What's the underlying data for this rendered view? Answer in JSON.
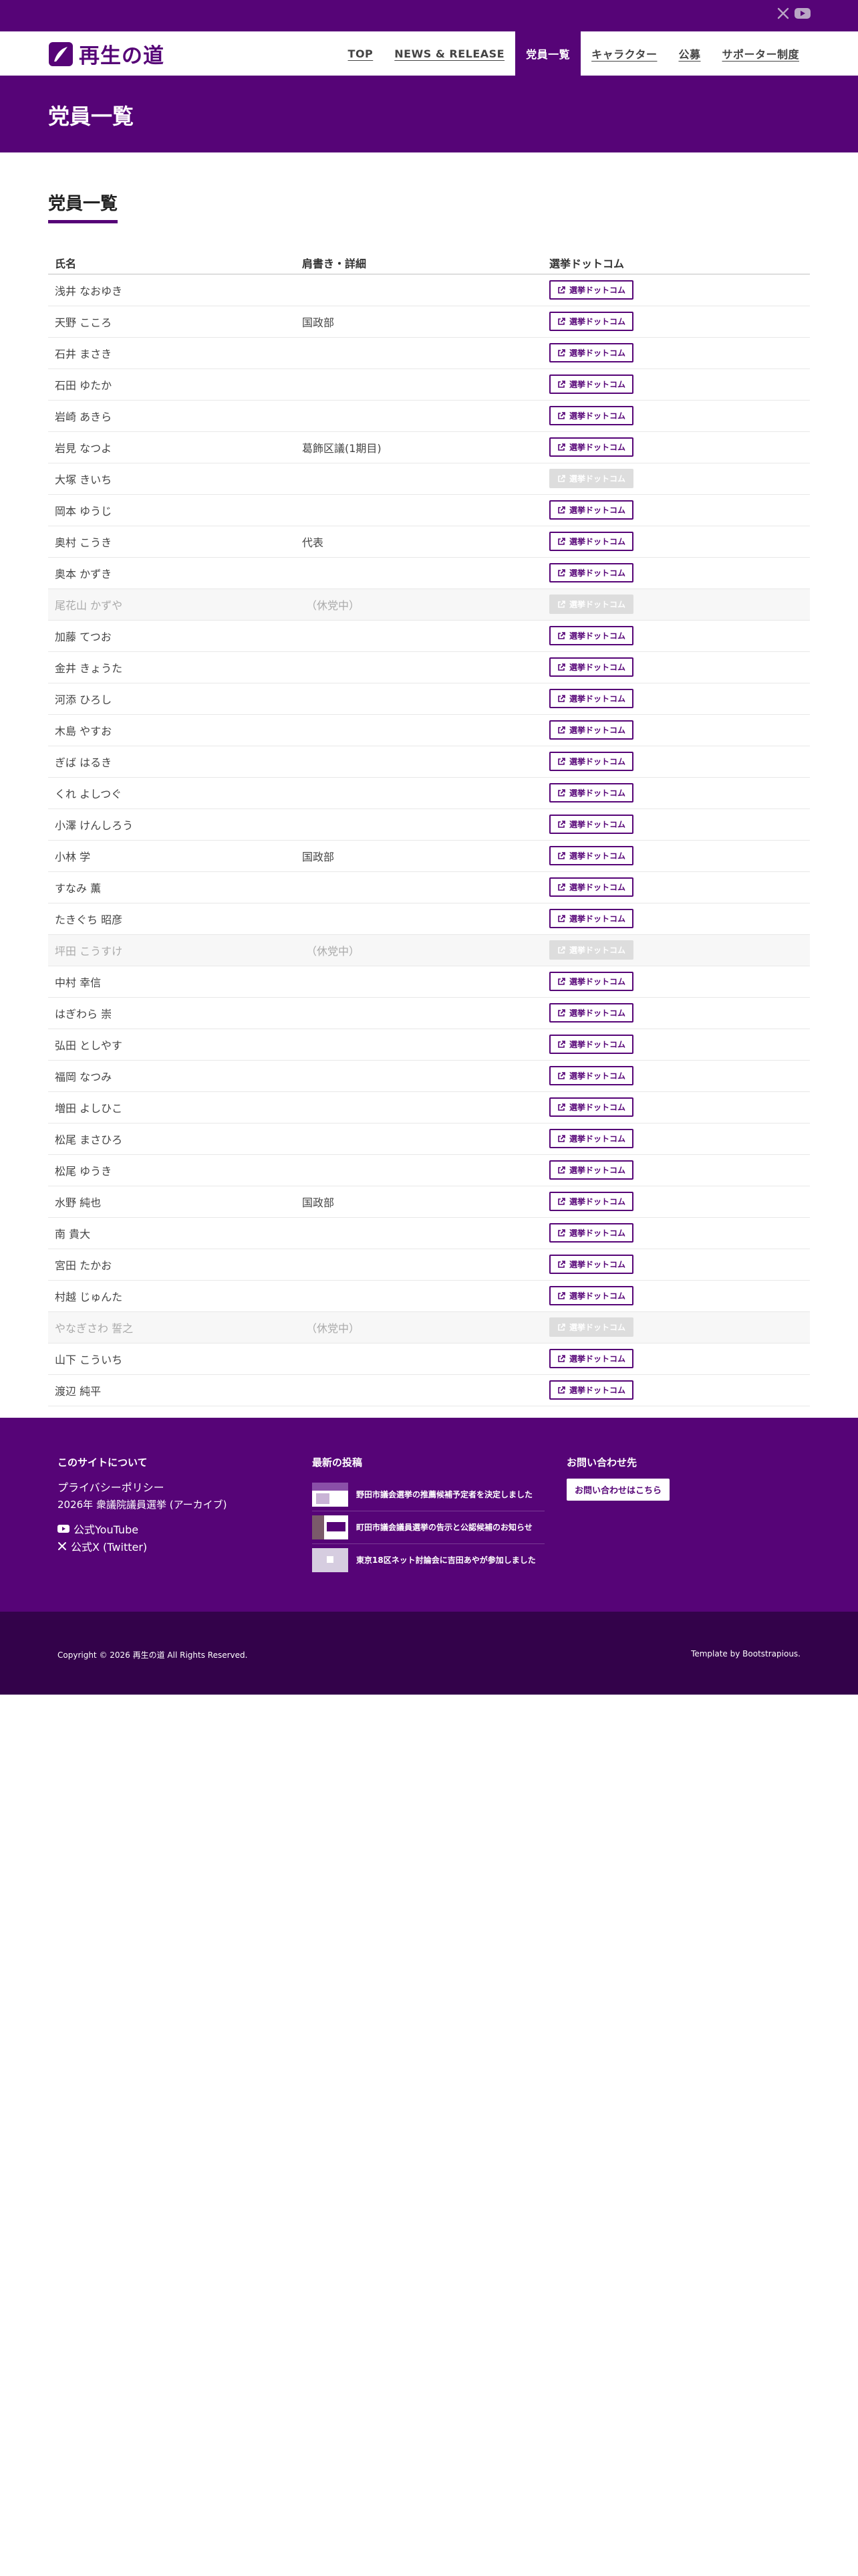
{
  "logo": {
    "text": "再生の道"
  },
  "topbar": {
    "icons": [
      "x-icon",
      "youtube-icon"
    ]
  },
  "nav": {
    "items": [
      {
        "label": "TOP",
        "active": false
      },
      {
        "label": "NEWS & RELEASE",
        "active": false
      },
      {
        "label": "党員一覧",
        "active": true
      },
      {
        "label": "キャラクター",
        "active": false
      },
      {
        "label": "公募",
        "active": false
      },
      {
        "label": "サポーター制度",
        "active": false
      }
    ]
  },
  "hero": {
    "title": "党員一覧"
  },
  "section": {
    "title": "党員一覧"
  },
  "table": {
    "headers": [
      "氏名",
      "肩書き・詳細",
      "選挙ドットコム"
    ],
    "button_label": "選挙ドットコム",
    "rows": [
      {
        "name": "浅井 なおゆき",
        "title": "",
        "active": true
      },
      {
        "name": "天野 こころ",
        "title": "国政部",
        "active": true
      },
      {
        "name": "石井 まさき",
        "title": "",
        "active": true
      },
      {
        "name": "石田 ゆたか",
        "title": "",
        "active": true
      },
      {
        "name": "岩崎 あきら",
        "title": "",
        "active": true
      },
      {
        "name": "岩見 なつよ",
        "title": "葛飾区議(1期目)",
        "active": true
      },
      {
        "name": "大塚 きいち",
        "title": "",
        "active": true,
        "button_disabled": true
      },
      {
        "name": "岡本 ゆうじ",
        "title": "",
        "active": true
      },
      {
        "name": "奥村 こうき",
        "title": "代表",
        "active": true
      },
      {
        "name": "奥本 かずき",
        "title": "",
        "active": true
      },
      {
        "name": "尾花山 かずや",
        "title": "（休党中）",
        "active": false
      },
      {
        "name": "加藤 てつお",
        "title": "",
        "active": true
      },
      {
        "name": "金井 きょうた",
        "title": "",
        "active": true
      },
      {
        "name": "河添 ひろし",
        "title": "",
        "active": true
      },
      {
        "name": "木島 やすお",
        "title": "",
        "active": true
      },
      {
        "name": "ぎば はるき",
        "title": "",
        "active": true
      },
      {
        "name": "くれ よしつぐ",
        "title": "",
        "active": true
      },
      {
        "name": "小澤 けんしろう",
        "title": "",
        "active": true
      },
      {
        "name": "小林 学",
        "title": "国政部",
        "active": true
      },
      {
        "name": "すなみ 薫",
        "title": "",
        "active": true
      },
      {
        "name": "たきぐち 昭彦",
        "title": "",
        "active": true
      },
      {
        "name": "坪田 こうすけ",
        "title": "（休党中）",
        "active": false
      },
      {
        "name": "中村 幸信",
        "title": "",
        "active": true
      },
      {
        "name": "はぎわら 崇",
        "title": "",
        "active": true
      },
      {
        "name": "弘田 としやす",
        "title": "",
        "active": true
      },
      {
        "name": "福岡 なつみ",
        "title": "",
        "active": true
      },
      {
        "name": "増田 よしひこ",
        "title": "",
        "active": true
      },
      {
        "name": "松尾 まさひろ",
        "title": "",
        "active": true
      },
      {
        "name": "松尾 ゆうき",
        "title": "",
        "active": true
      },
      {
        "name": "水野 純也",
        "title": "国政部",
        "active": true
      },
      {
        "name": "南 貴大",
        "title": "",
        "active": true
      },
      {
        "name": "宮田 たかお",
        "title": "",
        "active": true
      },
      {
        "name": "村越 じゅんた",
        "title": "",
        "active": true
      },
      {
        "name": "やなぎさわ 誓之",
        "title": "（休党中）",
        "active": false
      },
      {
        "name": "山下 こういち",
        "title": "",
        "active": true
      },
      {
        "name": "渡辺 純平",
        "title": "",
        "active": true
      }
    ]
  },
  "footer": {
    "about": {
      "heading": "このサイトについて",
      "privacy": "プライバシーポリシー",
      "archive": "2026年 衆議院議員選挙 (アーカイブ)",
      "youtube": "公式YouTube",
      "twitter": "公式X (Twitter)"
    },
    "posts": {
      "heading": "最新の投稿",
      "items": [
        "野田市議会選挙の推薦候補予定者を決定しました",
        "町田市議会議員選挙の告示と公認候補のお知らせ",
        "東京18区ネット討論会に吉田あやが参加しました"
      ]
    },
    "contact": {
      "heading": "お問い合わせ先",
      "button": "お問い合わせはこちら"
    }
  },
  "copyright": {
    "text": "Copyright © 2026 再生の道 All Rights Reserved.",
    "template": "Template by Bootstrapious."
  },
  "colors": {
    "brand": "#560477",
    "dark": "#33024a"
  }
}
